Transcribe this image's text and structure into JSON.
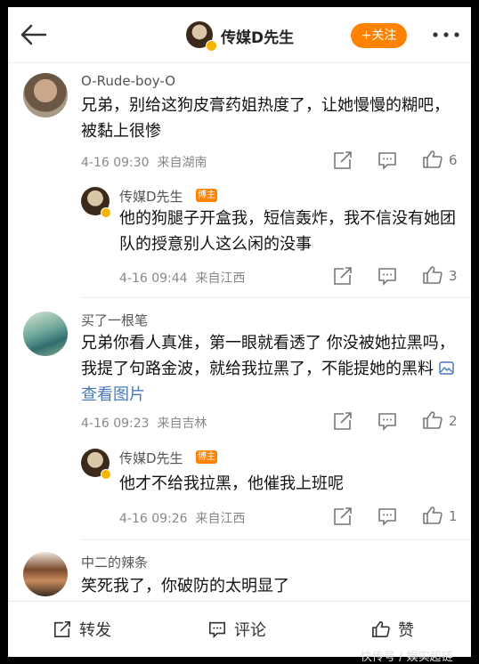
{
  "header": {
    "author_name": "传媒D先生",
    "follow_label": "+关注"
  },
  "badge_label": "博主",
  "comments": [
    {
      "name": "O-Rude-boy-O",
      "text": "兄弟，别给这狗皮膏药姐热度了，让她慢慢的糊吧，被黏上很惨",
      "time": "4-16 09:30",
      "location": "来自湖南",
      "likes": "6"
    },
    {
      "name": "传媒D先生",
      "text": "他的狗腿子开盒我，短信轰炸，我不信没有她团队的授意别人这么闲的没事",
      "time": "4-16 09:44",
      "location": "来自江西",
      "likes": "3"
    },
    {
      "name": "买了一根笔",
      "text": "兄弟你看人真准，第一眼就看透了 你没被她拉黑吗，我提了句路金波，就给我拉黑了，不能提她的黑料",
      "image_link": "查看图片",
      "time": "4-16 09:23",
      "location": "来自吉林",
      "likes": "2"
    },
    {
      "name": "传媒D先生",
      "text": "他才不给我拉黑，他催我上班呢",
      "time": "4-16 09:26",
      "location": "来自江西",
      "likes": "1"
    },
    {
      "name": "中二的辣条",
      "text": "笑死我了，你破防的太明显了"
    }
  ],
  "bottom_bar": {
    "repost": "转发",
    "comment": "评论",
    "like": "赞"
  },
  "watermark": "快传号 / 娱实超链",
  "colors": {
    "accent": "#ff8200",
    "link": "#4a79b5",
    "verified": "#f5b400"
  }
}
